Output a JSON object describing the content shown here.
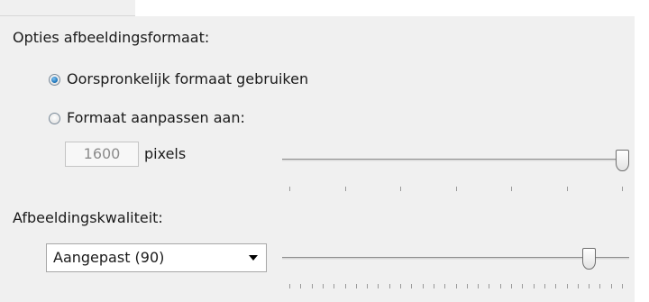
{
  "image_size": {
    "label": "Opties afbeeldingsformaat:",
    "option_original": {
      "label": "Oorspronkelijk formaat gebruiken",
      "selected": true
    },
    "option_resize": {
      "label": "Formaat aanpassen aan:",
      "selected": false
    },
    "pixels_value": "1600",
    "pixels_unit": "pixels",
    "slider_level": 1.0
  },
  "quality": {
    "label": "Afbeeldingskwaliteit:",
    "dropdown_value": "Aangepast (90)",
    "slider_level": 0.9
  },
  "icons": {
    "radio": "radio-icon",
    "dropdown": "chevron-down-icon"
  },
  "colors": {
    "panel_background": "#f0f0f0",
    "radio_selected": "#1d73b9",
    "disabled_text": "#8c8c8c"
  }
}
